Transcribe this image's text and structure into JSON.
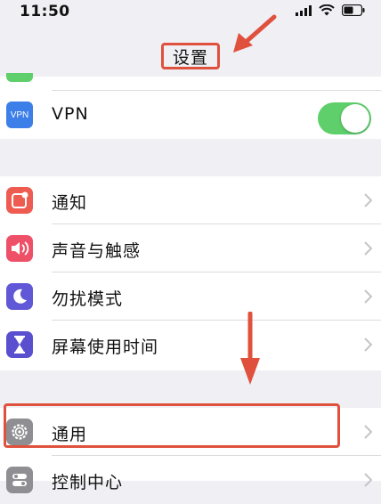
{
  "status_bar": {
    "time": "11:50",
    "signal_icon": "cellular-signal-icon",
    "wifi_icon": "wifi-icon",
    "battery_icon": "battery-icon"
  },
  "nav": {
    "title": "设置"
  },
  "colors": {
    "annotation_red": "#e0513d",
    "toggle_on": "#5fcf6b",
    "vpn_icon": "#3d7fe8",
    "notification_icon": "#ee5b50",
    "sound_icon": "#ee5068",
    "dnd_icon": "#6058d6",
    "screen_time_icon": "#5a4fcf",
    "general_icon": "#8e8e93"
  },
  "group1": {
    "vpn": {
      "label": "VPN",
      "icon": "vpn-icon",
      "icon_text": "VPN",
      "toggle_on": true
    }
  },
  "group2": {
    "items": [
      {
        "label": "通知",
        "icon": "notification-icon"
      },
      {
        "label": "声音与触感",
        "icon": "speaker-icon"
      },
      {
        "label": "勿扰模式",
        "icon": "moon-icon"
      },
      {
        "label": "屏幕使用时间",
        "icon": "hourglass-icon"
      }
    ]
  },
  "group3": {
    "items": [
      {
        "label": "通用",
        "icon": "gear-icon"
      },
      {
        "label": "控制中心",
        "icon": "toggles-icon"
      }
    ]
  },
  "annotations": {
    "arrow_to_title": "red-arrow-icon",
    "arrow_to_general": "red-arrow-icon"
  }
}
